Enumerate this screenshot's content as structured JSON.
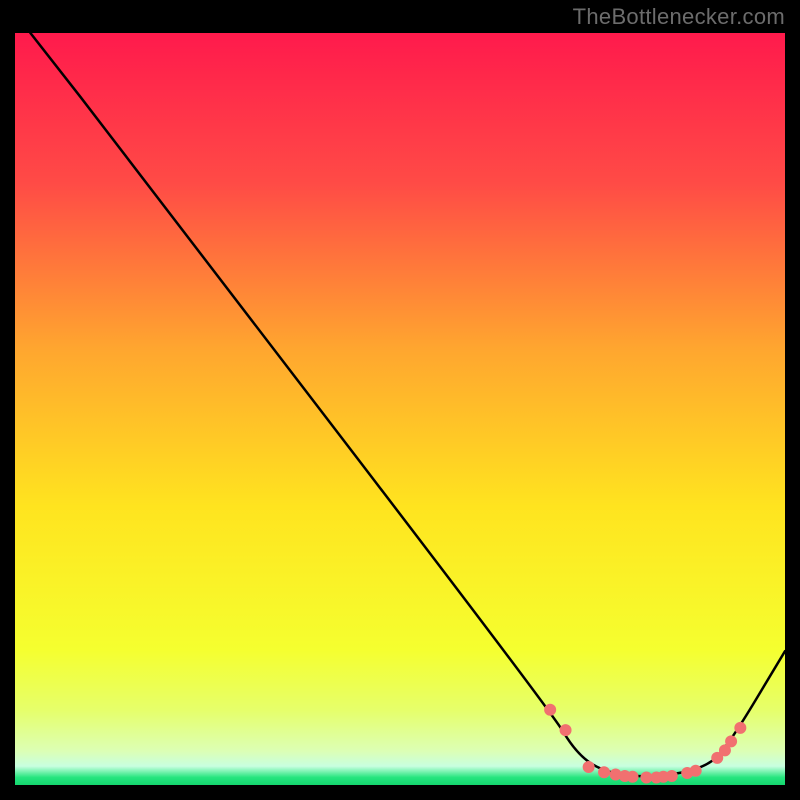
{
  "attribution": "TheBottlenecker.com",
  "colors": {
    "gradient_stops": [
      {
        "offset": 0.0,
        "color": "#ff1a4c"
      },
      {
        "offset": 0.2,
        "color": "#ff4b46"
      },
      {
        "offset": 0.42,
        "color": "#ffa62f"
      },
      {
        "offset": 0.63,
        "color": "#ffe41f"
      },
      {
        "offset": 0.82,
        "color": "#f5ff2f"
      },
      {
        "offset": 0.9,
        "color": "#e6ff6a"
      },
      {
        "offset": 0.955,
        "color": "#dcffb5"
      },
      {
        "offset": 0.975,
        "color": "#c8ffe0"
      },
      {
        "offset": 0.99,
        "color": "#25e57e"
      },
      {
        "offset": 1.0,
        "color": "#14d66e"
      }
    ],
    "line": "#000000",
    "marker_fill": "#f17070",
    "marker_stroke": "#f17070"
  },
  "chart_data": {
    "type": "line",
    "title": "",
    "xlabel": "",
    "ylabel": "",
    "xlim": [
      0,
      100
    ],
    "ylim": [
      0,
      100
    ],
    "series": [
      {
        "name": "curve",
        "points": [
          {
            "x": 2.0,
            "y": 100.0
          },
          {
            "x": 8.5,
            "y": 91.5
          },
          {
            "x": 69.5,
            "y": 10.0
          },
          {
            "x": 73.0,
            "y": 4.0
          },
          {
            "x": 77.0,
            "y": 1.5
          },
          {
            "x": 83.0,
            "y": 1.0
          },
          {
            "x": 89.5,
            "y": 2.2
          },
          {
            "x": 92.5,
            "y": 5.0
          },
          {
            "x": 100.0,
            "y": 17.8
          }
        ]
      }
    ],
    "markers": [
      {
        "x": 69.5,
        "y": 10.0
      },
      {
        "x": 71.5,
        "y": 7.3
      },
      {
        "x": 74.5,
        "y": 2.4
      },
      {
        "x": 76.5,
        "y": 1.7
      },
      {
        "x": 78.0,
        "y": 1.4
      },
      {
        "x": 79.2,
        "y": 1.2
      },
      {
        "x": 80.2,
        "y": 1.1
      },
      {
        "x": 82.0,
        "y": 1.0
      },
      {
        "x": 83.3,
        "y": 1.0
      },
      {
        "x": 84.2,
        "y": 1.1
      },
      {
        "x": 85.3,
        "y": 1.2
      },
      {
        "x": 87.3,
        "y": 1.6
      },
      {
        "x": 88.4,
        "y": 1.9
      },
      {
        "x": 91.2,
        "y": 3.6
      },
      {
        "x": 92.2,
        "y": 4.6
      },
      {
        "x": 93.0,
        "y": 5.8
      },
      {
        "x": 94.2,
        "y": 7.6
      }
    ]
  }
}
